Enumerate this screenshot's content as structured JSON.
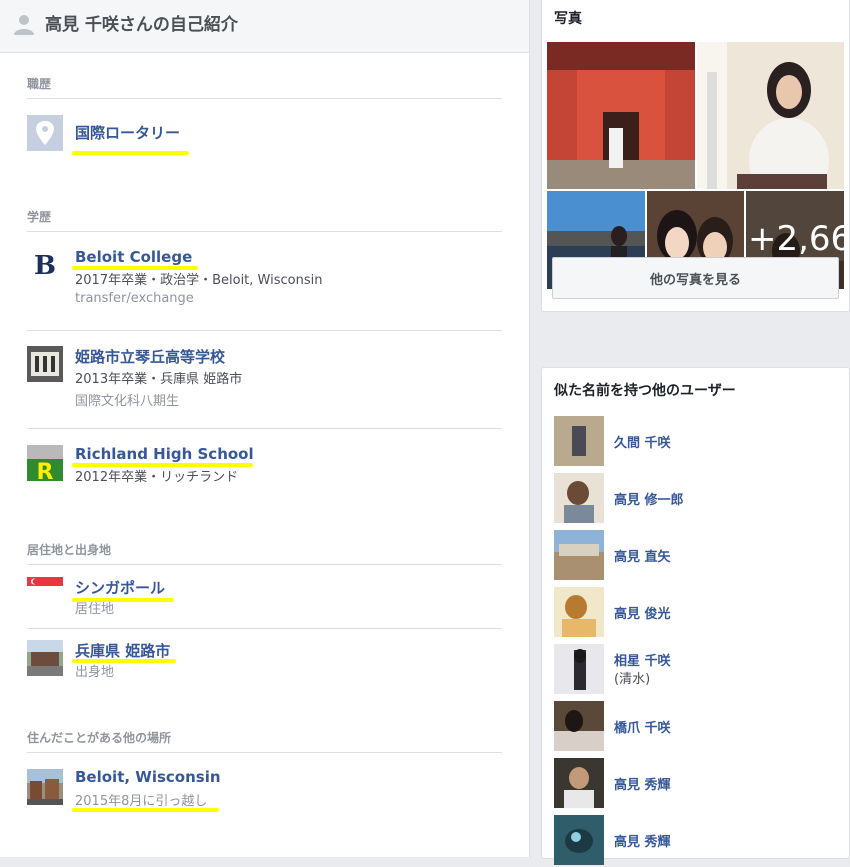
{
  "header": {
    "title": "高見 千咲さんの自己紹介"
  },
  "work": {
    "heading": "職歴",
    "items": [
      {
        "name": "国際ロータリー"
      }
    ]
  },
  "education": {
    "heading": "学歴",
    "items": [
      {
        "name": "Beloit College",
        "detail": "2017年卒業・政治学・Beloit, Wisconsin",
        "note": "transfer/exchange"
      },
      {
        "name": "姫路市立琴丘高等学校",
        "detail": "2013年卒業・兵庫県 姫路市",
        "note": "国際文化科八期生"
      },
      {
        "name": "Richland High School",
        "detail": "2012年卒業・リッチランド"
      }
    ]
  },
  "places": {
    "heading": "居住地と出身地",
    "items": [
      {
        "name": "シンガポール",
        "detail": "居住地"
      },
      {
        "name": "兵庫県 姫路市",
        "detail": "出身地"
      }
    ]
  },
  "other_places": {
    "heading": "住んだことがある他の場所",
    "items": [
      {
        "name": "Beloit, Wisconsin",
        "detail": "2015年8月に引っ越し"
      }
    ]
  },
  "photos": {
    "title": "写真",
    "more_count": "+2,66",
    "button_label": "他の写真を見る"
  },
  "similar": {
    "title": "似た名前を持つ他のユーザー",
    "users": [
      {
        "name": "久間 千咲"
      },
      {
        "name": "高見 修一郎"
      },
      {
        "name": "高見 直矢"
      },
      {
        "name": "高見 俊光"
      },
      {
        "name": "相星 千咲",
        "note": "(清水)"
      },
      {
        "name": "橋爪 千咲"
      },
      {
        "name": "高見 秀輝"
      },
      {
        "name": "高見 秀輝"
      }
    ]
  },
  "colors": {
    "link": "#365899",
    "highlight": "#ffff00",
    "accent_b": "#1c2f5b",
    "accent_r": "#2e8b2e"
  }
}
